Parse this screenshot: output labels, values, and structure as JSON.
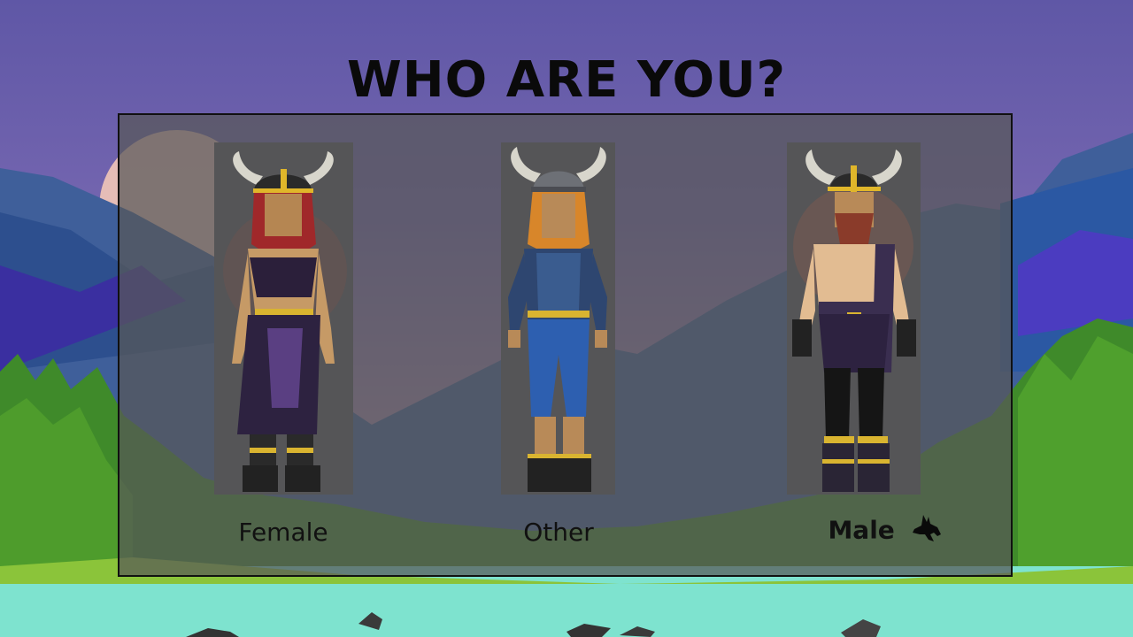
{
  "screen": {
    "title": "WHO ARE YOU?"
  },
  "characters": [
    {
      "id": "female",
      "label": "Female",
      "selected": false
    },
    {
      "id": "other",
      "label": "Other",
      "selected": false
    },
    {
      "id": "male",
      "label": "Male",
      "selected": true
    }
  ],
  "selection_icon": "raven-icon",
  "colors": {
    "sky_top": "#6a5aa8",
    "sky_bottom": "#c39aa8",
    "panel": "#585858",
    "water": "#73e3d2",
    "grass": "#5ea52a",
    "gold": "#e2b528"
  }
}
